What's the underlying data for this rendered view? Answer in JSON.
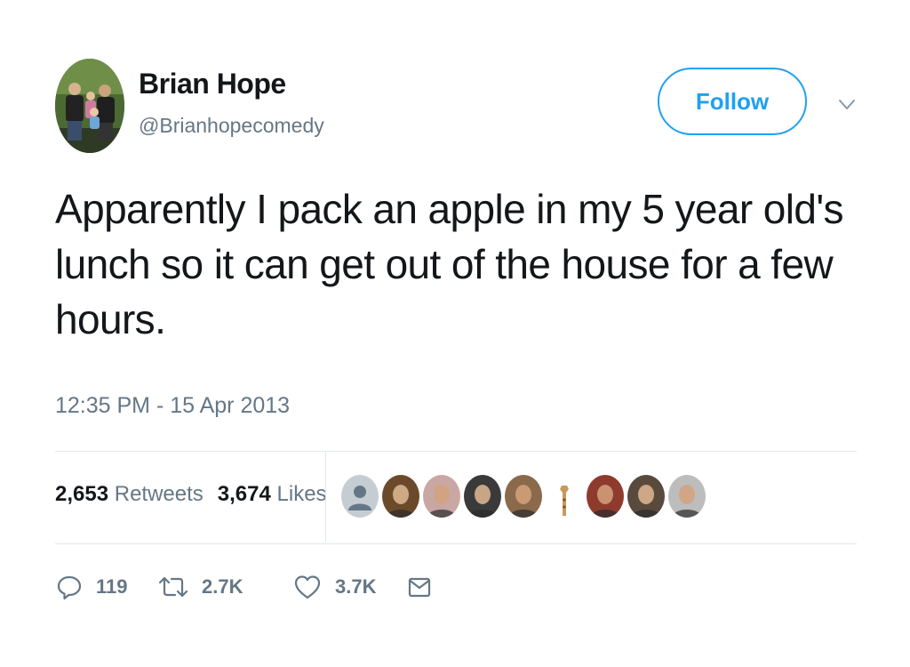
{
  "author": {
    "name": "Brian Hope",
    "handle": "@Brianhopecomedy"
  },
  "follow_label": "Follow",
  "tweet": {
    "text": "Apparently I pack an apple in my 5 year old's lunch so it can get out of the house for a few hours.",
    "timestamp": "12:35 PM - 15 Apr 2013"
  },
  "stats": {
    "retweets_count": "2,653",
    "retweets_label": "Retweets",
    "likes_count": "3,674",
    "likes_label": "Likes"
  },
  "likers": [
    {
      "icon": "default-avatar-icon",
      "bg": "#c5cdd3"
    },
    {
      "icon": "user-avatar",
      "bg": "#6b4a2b"
    },
    {
      "icon": "user-avatar",
      "bg": "#c9a7a3"
    },
    {
      "icon": "user-avatar",
      "bg": "#3a3a3a"
    },
    {
      "icon": "user-avatar",
      "bg": "#8a6a4a"
    },
    {
      "icon": "giraffe-avatar",
      "bg": "#ffffff"
    },
    {
      "icon": "user-avatar",
      "bg": "#8e3b2e"
    },
    {
      "icon": "user-avatar",
      "bg": "#5a4a3e"
    },
    {
      "icon": "user-avatar",
      "bg": "#bdbdbd"
    }
  ],
  "actions": {
    "replies": "119",
    "retweets": "2.7K",
    "likes": "3.7K"
  },
  "icons": {
    "reply": "reply-icon",
    "retweet": "retweet-icon",
    "like": "heart-icon",
    "dm": "envelope-icon",
    "more": "chevron-down-icon"
  },
  "colors": {
    "accent": "#1da1f2",
    "text": "#14171a",
    "muted": "#657786",
    "divider": "#e1e8ed"
  }
}
